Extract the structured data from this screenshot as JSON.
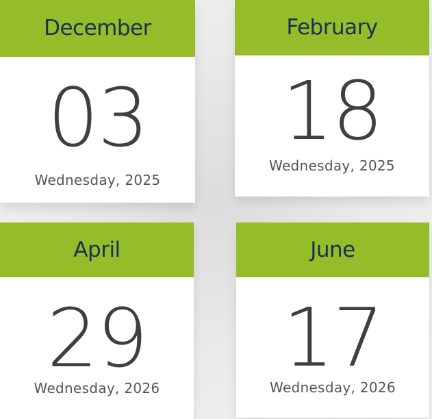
{
  "colors": {
    "header_green": "#95bd29",
    "month_text": "#1b2f52",
    "day_text": "#3f3f3f",
    "sub_text": "#555555",
    "card_bg": "#ffffff"
  },
  "cards": [
    {
      "month": "December",
      "day": "03",
      "subtitle": "Wednesday, 2025"
    },
    {
      "month": "February",
      "day": "18",
      "subtitle": "Wednesday, 2025"
    },
    {
      "month": "April",
      "day": "29",
      "subtitle": "Wednesday, 2026"
    },
    {
      "month": "June",
      "day": "17",
      "subtitle": "Wednesday, 2026"
    }
  ]
}
